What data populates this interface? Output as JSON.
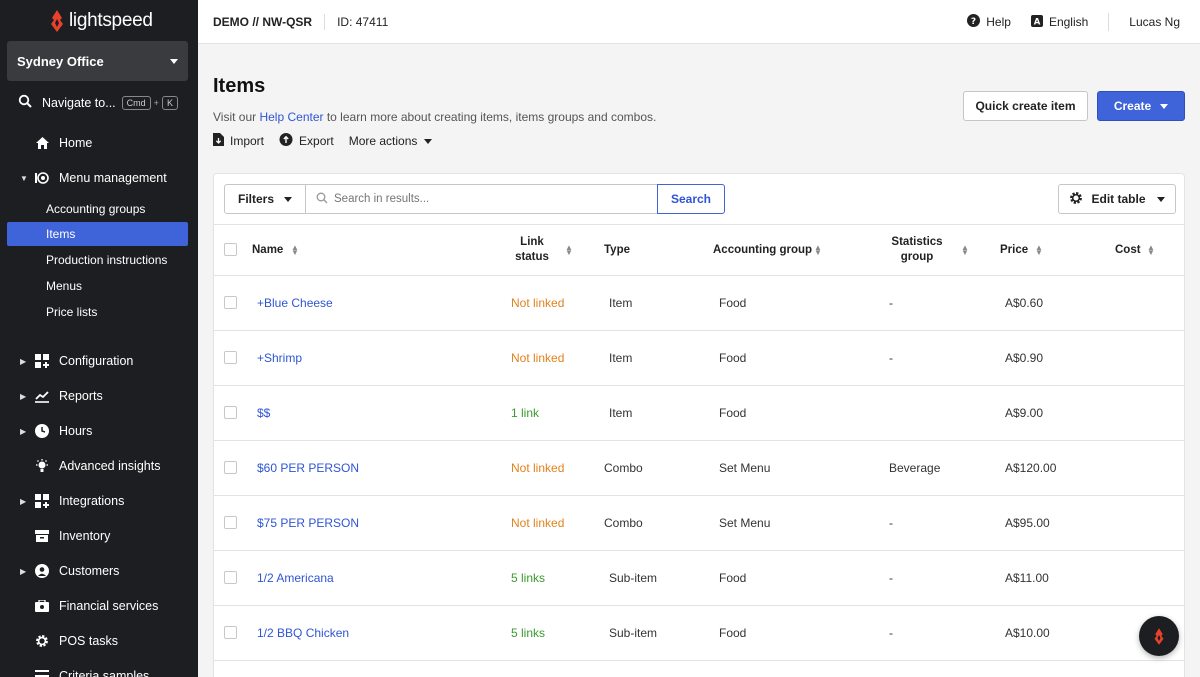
{
  "brand": {
    "name": "lightspeed",
    "accent": "#e8412c",
    "primary": "#3f63d9"
  },
  "sidebar": {
    "location": "Sydney Office",
    "navigate": {
      "label": "Navigate to...",
      "key1": "Cmd",
      "plus": "+",
      "key2": "K"
    },
    "items": [
      {
        "label": "Home",
        "icon": "home-icon"
      },
      {
        "label": "Menu management",
        "icon": "menu-management-icon",
        "expanded": true
      },
      {
        "label": "Configuration",
        "icon": "configuration-icon"
      },
      {
        "label": "Reports",
        "icon": "reports-icon"
      },
      {
        "label": "Hours",
        "icon": "clock-icon"
      },
      {
        "label": "Advanced insights",
        "icon": "insights-icon"
      },
      {
        "label": "Integrations",
        "icon": "integrations-icon"
      },
      {
        "label": "Inventory",
        "icon": "inventory-icon"
      },
      {
        "label": "Customers",
        "icon": "customers-icon"
      },
      {
        "label": "Financial services",
        "icon": "financial-icon"
      },
      {
        "label": "POS tasks",
        "icon": "gear-icon"
      },
      {
        "label": "Criteria samples",
        "icon": "list-icon"
      }
    ],
    "sub_items": [
      {
        "label": "Accounting groups"
      },
      {
        "label": "Items",
        "active": true
      },
      {
        "label": "Production instructions"
      },
      {
        "label": "Menus"
      },
      {
        "label": "Price lists"
      }
    ]
  },
  "topbar": {
    "account": "DEMO // NW-QSR",
    "id": "ID: 47411",
    "help": "Help",
    "language": "English",
    "user": "Lucas Ng"
  },
  "page": {
    "title": "Items",
    "subtitle_before": "Visit our ",
    "subtitle_link": "Help Center",
    "subtitle_after": " to learn more about creating items, items groups and combos.",
    "import": "Import",
    "export": "Export",
    "more_actions": "More actions",
    "quick_create": "Quick create item",
    "create": "Create"
  },
  "toolbar": {
    "filters": "Filters",
    "search_placeholder": "Search in results...",
    "search_button": "Search",
    "edit_table": "Edit table"
  },
  "table": {
    "columns": {
      "name": "Name",
      "link_status_1": "Link",
      "link_status_2": "status",
      "type": "Type",
      "accounting_group": "Accounting group",
      "statistics_group_1": "Statistics",
      "statistics_group_2": "group",
      "price": "Price",
      "cost": "Cost"
    },
    "rows": [
      {
        "name": "+Blue Cheese",
        "link": "Not linked",
        "link_state": "orange",
        "type": "Item",
        "accounting": "Food",
        "statistics": "-",
        "price": "A$0.60",
        "cost": ""
      },
      {
        "name": "+Shrimp",
        "link": "Not linked",
        "link_state": "orange",
        "type": "Item",
        "accounting": "Food",
        "statistics": "-",
        "price": "A$0.90",
        "cost": ""
      },
      {
        "name": "$$",
        "link": "1 link",
        "link_state": "green",
        "type": "Item",
        "accounting": "Food",
        "statistics": "",
        "price": "A$9.00",
        "cost": ""
      },
      {
        "name": "$60 PER PERSON",
        "link": "Not linked",
        "link_state": "orange",
        "type": "Combo",
        "accounting": "Set Menu",
        "statistics": "Beverage",
        "price": "A$120.00",
        "cost": ""
      },
      {
        "name": "$75 PER PERSON",
        "link": "Not linked",
        "link_state": "orange",
        "type": "Combo",
        "accounting": "Set Menu",
        "statistics": "-",
        "price": "A$95.00",
        "cost": ""
      },
      {
        "name": "1/2 Americana",
        "link": "5 links",
        "link_state": "green",
        "type": "Sub-item",
        "accounting": "Food",
        "statistics": "-",
        "price": "A$11.00",
        "cost": ""
      },
      {
        "name": "1/2 BBQ Chicken",
        "link": "5 links",
        "link_state": "green",
        "type": "Sub-item",
        "accounting": "Food",
        "statistics": "-",
        "price": "A$10.00",
        "cost": ""
      }
    ]
  }
}
